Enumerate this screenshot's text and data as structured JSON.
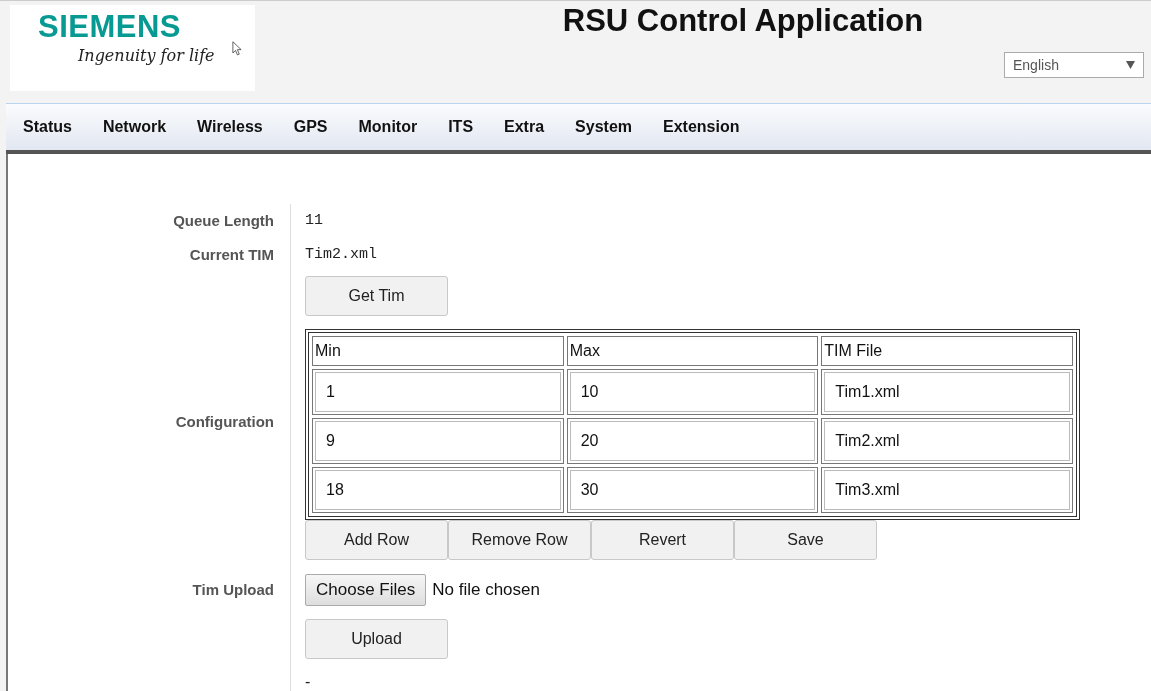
{
  "logo": {
    "brand": "SIEMENS",
    "tagline": "Ingenuity for life"
  },
  "title": "RSU Control Application",
  "language": {
    "value": "English"
  },
  "nav": [
    {
      "label": "Status"
    },
    {
      "label": "Network"
    },
    {
      "label": "Wireless"
    },
    {
      "label": "GPS"
    },
    {
      "label": "Monitor"
    },
    {
      "label": "ITS"
    },
    {
      "label": "Extra"
    },
    {
      "label": "System"
    },
    {
      "label": "Extension"
    }
  ],
  "queue_length": {
    "label": "Queue Length",
    "value": "11"
  },
  "current_tim": {
    "label": "Current TIM",
    "value": "Tim2.xml",
    "button": "Get Tim"
  },
  "configuration": {
    "label": "Configuration",
    "columns": [
      "Min",
      "Max",
      "TIM File"
    ],
    "rows": [
      [
        "1",
        "10",
        "Tim1.xml"
      ],
      [
        "9",
        "20",
        "Tim2.xml"
      ],
      [
        "18",
        "30",
        "Tim3.xml"
      ]
    ],
    "buttons": [
      "Add Row",
      "Remove Row",
      "Revert",
      "Save"
    ]
  },
  "tim_upload": {
    "label": "Tim Upload",
    "choose_button": "Choose Files",
    "file_status": "No file chosen",
    "upload_button": "Upload",
    "result": "-"
  }
}
